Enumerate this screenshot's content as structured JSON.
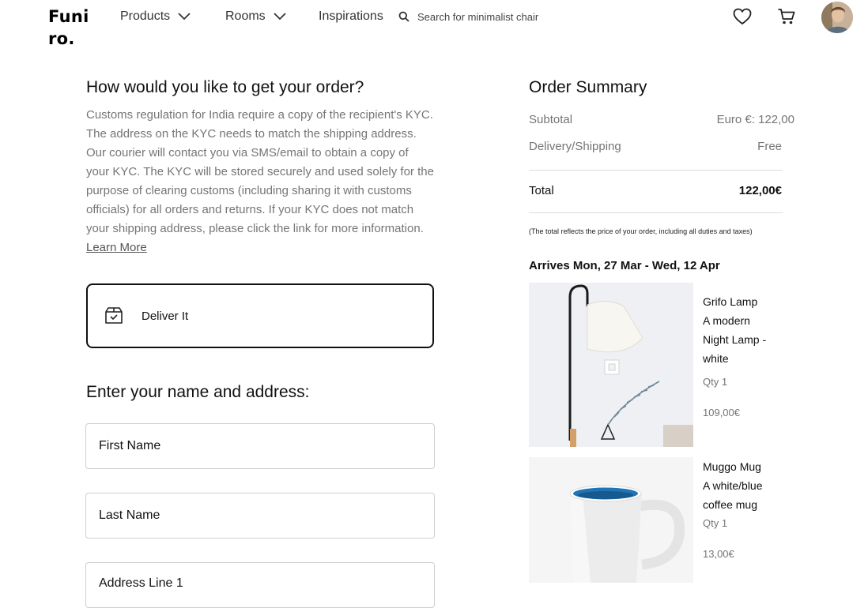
{
  "header": {
    "logo": "Funiro.",
    "nav": {
      "products": "Products",
      "rooms": "Rooms",
      "inspirations": "Inspirations"
    },
    "search_placeholder": "Search for minimalist chair"
  },
  "delivery": {
    "heading": "How would you like to get your order?",
    "customs_text": "Customs regulation for India require a copy of the recipient's KYC. The address on the KYC needs to match the shipping address. Our courier will contact you via SMS/email to obtain a copy of your KYC. The KYC will be stored securely and used solely for the purpose of clearing customs (including sharing it with customs officials) for all orders and returns. If your KYC does not match your shipping address, please click the link for more information.",
    "learn_more": "Learn More",
    "option_label": "Deliver It"
  },
  "address": {
    "heading": "Enter your name and address:",
    "first_name": "First Name",
    "last_name": "Last Name",
    "address_line_1": "Address Line 1"
  },
  "summary": {
    "heading": "Order Summary",
    "subtotal_label": "Subtotal",
    "subtotal_value": "Euro €: 122,00",
    "shipping_label": "Delivery/Shipping",
    "shipping_value": "Free",
    "total_label": "Total",
    "total_value": "122,00€",
    "note": "(The total reflects the price of your order, including all duties and taxes)",
    "arrives": "Arrives Mon, 27 Mar - Wed, 12 Apr"
  },
  "items": [
    {
      "name": "Grifo Lamp",
      "desc_1": "A modern",
      "desc_2": "Night Lamp -",
      "desc_3": "white",
      "qty": "Qty 1",
      "price": "109,00€"
    },
    {
      "name": "Muggo Mug",
      "desc_1": "A white/blue",
      "desc_2": "coffee mug",
      "qty": "Qty 1",
      "price": "13,00€"
    }
  ],
  "colors": {
    "text": "#111111",
    "muted": "#757575",
    "border": "#cfcfcf"
  }
}
